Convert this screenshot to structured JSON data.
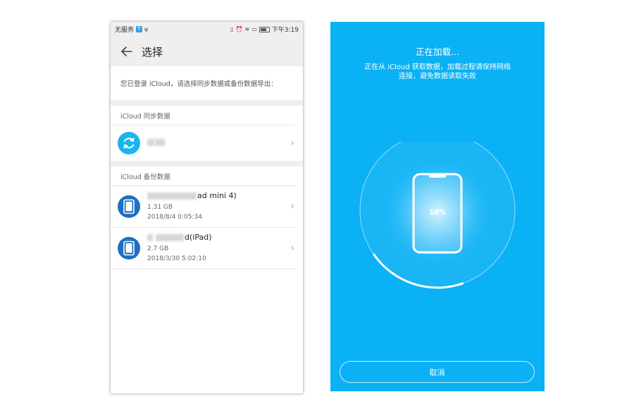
{
  "left": {
    "status_bar": {
      "carrier": "无服务",
      "badge": "T",
      "usb_glyph": "ψ",
      "time": "下午3:19"
    },
    "app_bar": {
      "title": "选择"
    },
    "notice": "您已登录 iCloud，请选择同步数据或备份数据导出：",
    "sync_section": {
      "header": "iCloud 同步数据",
      "item": {
        "name_hidden": true
      }
    },
    "backup_section": {
      "header": "iCloud 备份数据",
      "items": [
        {
          "name_visible": "ad mini 4)",
          "size": "1.31 GB",
          "date": "2018/8/4 0:05:34"
        },
        {
          "name_visible": "d(iPad)",
          "size": "2.7 GB",
          "date": "2018/3/30 5:02:10"
        }
      ]
    },
    "chevron": "›"
  },
  "right": {
    "title": "正在加载...",
    "desc_line1": "正在从 iCloud 获取数据，加载过程请保持网络",
    "desc_line2": "连接，避免数据读取失败",
    "percent_label": "19%",
    "progress": 0.19,
    "cancel_label": "取消"
  },
  "colors": {
    "right_bg": "#0bb1f5",
    "sync_icon": "#1ab4ee",
    "ipad_icon": "#1e6fc0",
    "header_bg": "#efefef"
  },
  "icons": {
    "back": "arrow-left-icon",
    "sync": "sync-icon",
    "device": "ipad-icon",
    "chevron": "chevron-right-icon"
  }
}
